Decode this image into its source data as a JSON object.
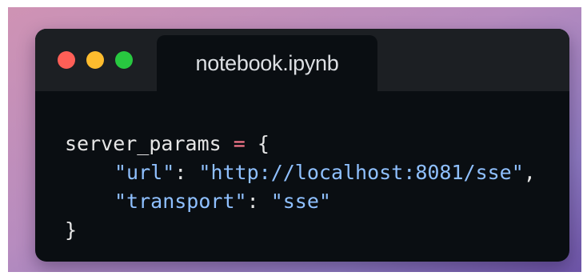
{
  "window": {
    "tab_title": "notebook.ipynb",
    "traffic_lights": [
      "close-dot",
      "minimize-dot",
      "maximize-dot"
    ]
  },
  "code": {
    "line1": {
      "var": "server_params",
      "op": "=",
      "brace": "{"
    },
    "line2": {
      "key": "\"url\"",
      "colon": ":",
      "value": "\"http://localhost:8081/sse\"",
      "comma": ","
    },
    "line3": {
      "key": "\"transport\"",
      "colon": ":",
      "value": "\"sse\""
    },
    "line4": {
      "brace": "}"
    }
  },
  "colors": {
    "background_gradient_start": "#cf93b4",
    "background_gradient_end": "#6e55a8",
    "editor_bg": "#0a0e12",
    "titlebar_bg": "#1c1f23",
    "string": "#8fc0ff",
    "operator": "#ff7b8f",
    "text": "#e6e6e6"
  }
}
